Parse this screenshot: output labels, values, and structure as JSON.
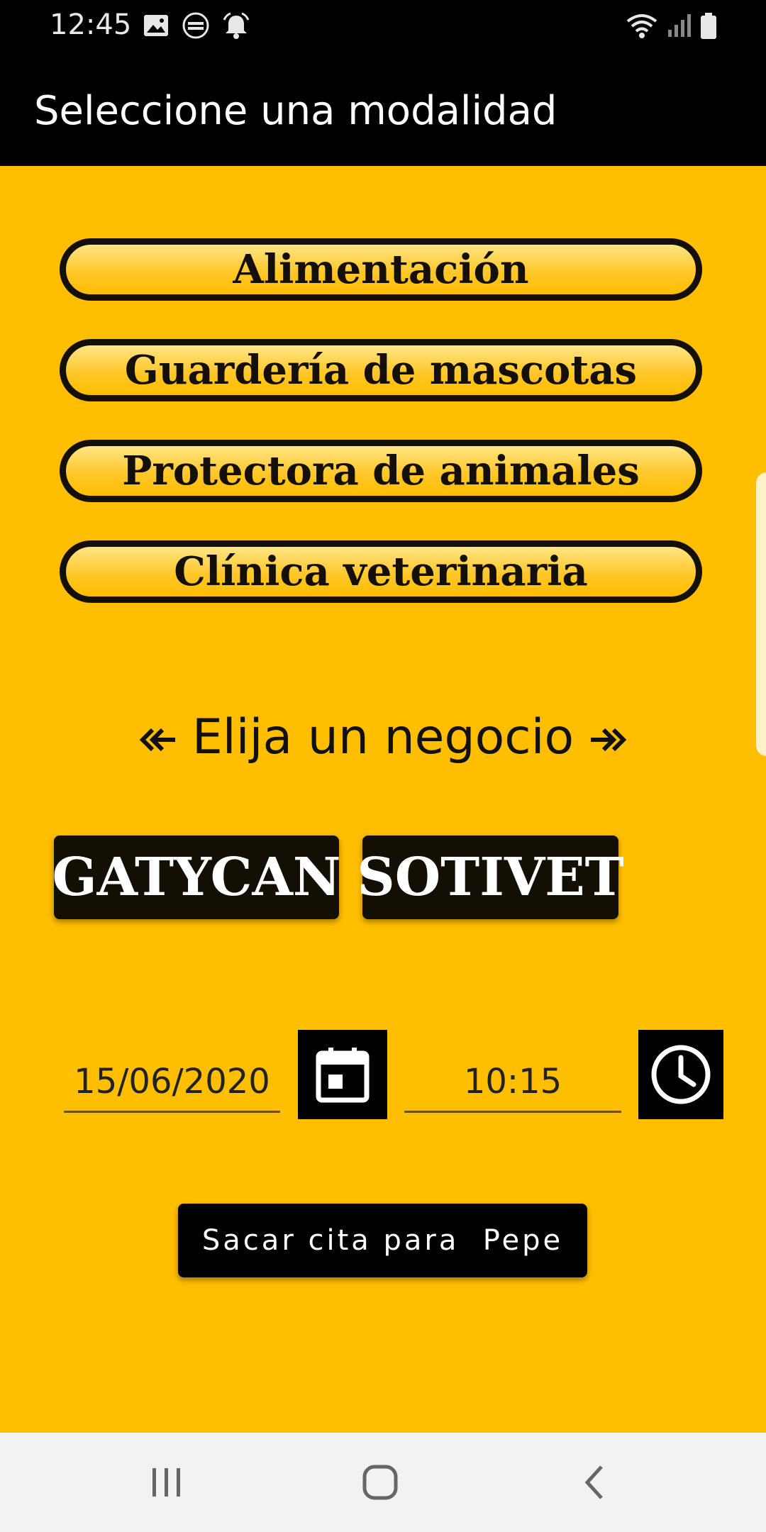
{
  "status_bar": {
    "time": "12:45",
    "icons_left": [
      "image-icon",
      "burger-king-icon",
      "alarm-icon"
    ],
    "icons_right": [
      "wifi-icon",
      "signal-icon",
      "battery-icon"
    ]
  },
  "app_bar": {
    "title": "Seleccione una modalidad"
  },
  "modalities": [
    "Alimentación",
    "Guardería de mascotas",
    "Protectora de animales",
    "Clínica veterinaria"
  ],
  "business_header": "Elija un negocio",
  "businesses": [
    "GATYCAN",
    "SOTIVET"
  ],
  "appointment": {
    "date": "15/06/2020",
    "time": "10:15",
    "submit_label": "Sacar cita para  Pepe"
  },
  "colors": {
    "background": "#FFBE00",
    "bar": "#000000",
    "button_dark": "#140F05"
  }
}
